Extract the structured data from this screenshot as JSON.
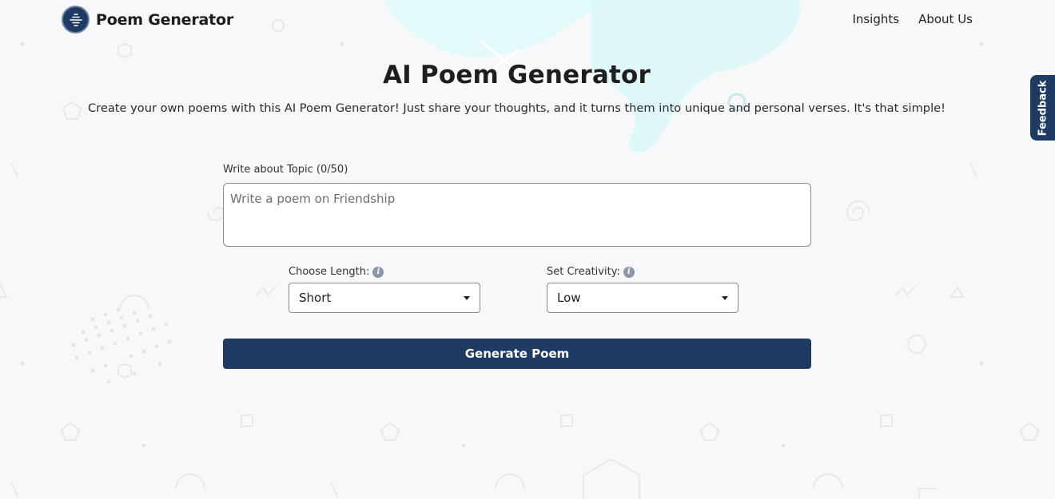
{
  "brand": {
    "name": "Poem Generator",
    "logo_icon": "sound-wave-icon"
  },
  "nav": {
    "items": [
      {
        "label": "Insights"
      },
      {
        "label": "About Us"
      }
    ]
  },
  "hero": {
    "title": "AI Poem Generator",
    "subtitle": "Create your own poems with this AI Poem Generator! Just share your thoughts, and it turns them into unique and personal verses. It's that simple!"
  },
  "form": {
    "topic_label": "Write about Topic (0/50)",
    "topic_value": "",
    "topic_placeholder": "Write a poem on Friendship",
    "length_label": "Choose Length:",
    "length_value": "Short",
    "creativity_label": "Set Creativity:",
    "creativity_value": "Low",
    "generate_label": "Generate Poem"
  },
  "feedback": {
    "label": "Feedback"
  },
  "colors": {
    "primary": "#1f3b63",
    "accent_blob": "#d9f7f8",
    "background": "#f7f8fa"
  }
}
